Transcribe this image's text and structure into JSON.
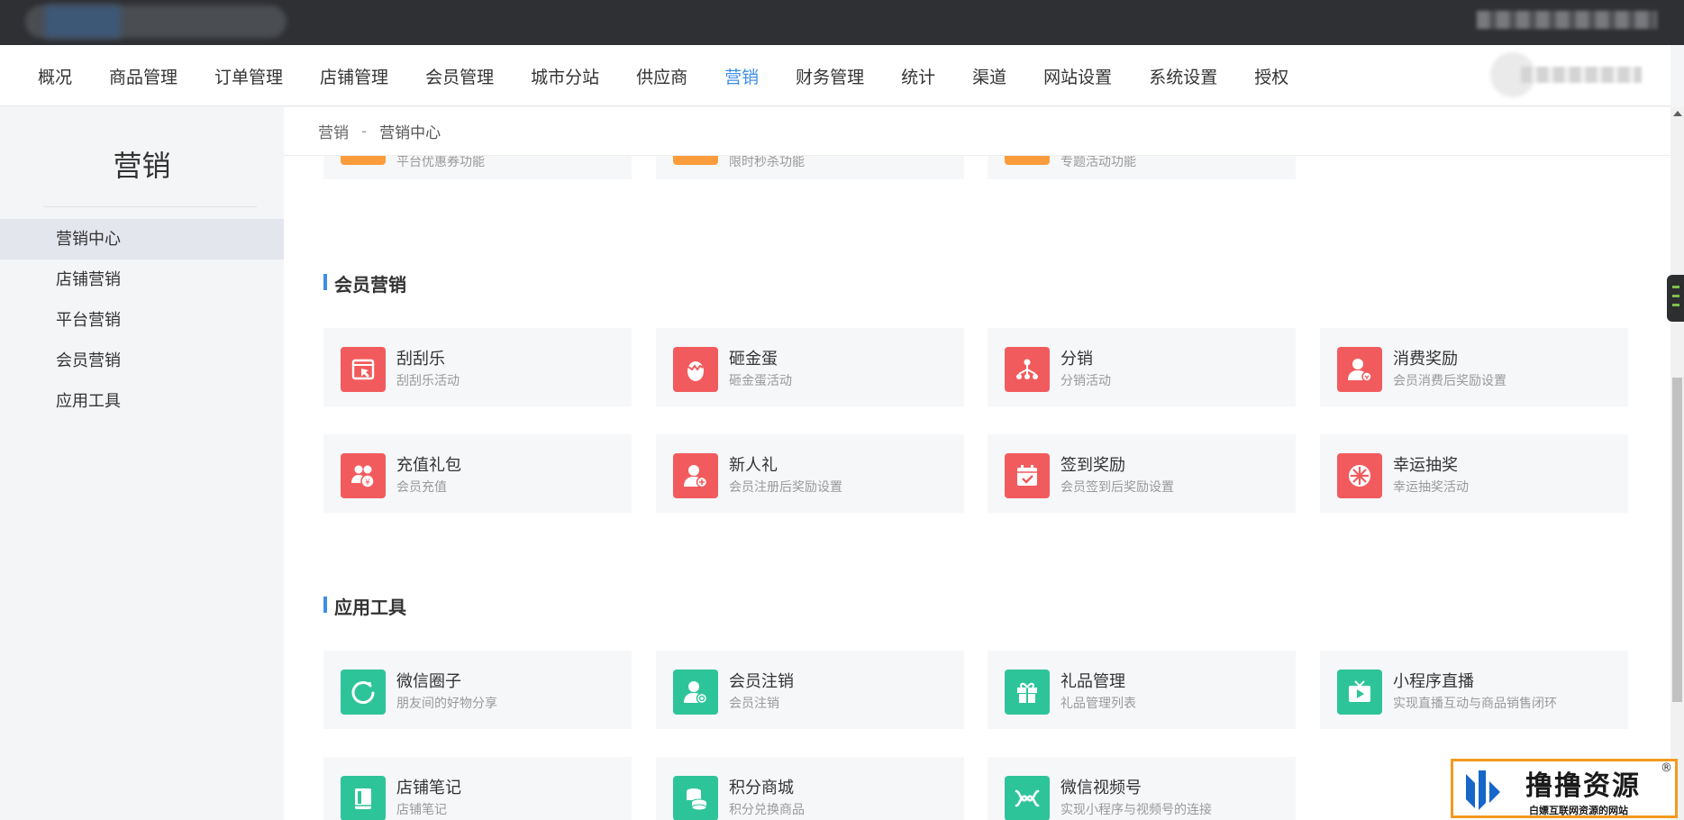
{
  "nav": {
    "items": [
      "概况",
      "商品管理",
      "订单管理",
      "店铺管理",
      "会员管理",
      "城市分站",
      "供应商",
      "营销",
      "财务管理",
      "统计",
      "渠道",
      "网站设置",
      "系统设置",
      "授权"
    ],
    "active_index": 7
  },
  "sidebar": {
    "title": "营销",
    "items": [
      "营销中心",
      "店铺营销",
      "平台营销",
      "会员营销",
      "应用工具"
    ],
    "active_index": 0
  },
  "breadcrumb": {
    "parent": "营销",
    "separator": "-",
    "current": "营销中心"
  },
  "top_cards": [
    {
      "desc": "平台优惠券功能",
      "icon": "coupon-icon",
      "color": "#fb9c3c"
    },
    {
      "desc": "限时秒杀功能",
      "icon": "flash-sale-icon",
      "color": "#fb9c3c"
    },
    {
      "desc": "专题活动功能",
      "icon": "topic-icon",
      "color": "#fb9c3c"
    }
  ],
  "sections": {
    "member": {
      "title": "会员营销",
      "cards": [
        {
          "title": "刮刮乐",
          "desc": "刮刮乐活动",
          "icon": "scratch-card-icon"
        },
        {
          "title": "砸金蛋",
          "desc": "砸金蛋活动",
          "icon": "golden-egg-icon"
        },
        {
          "title": "分销",
          "desc": "分销活动",
          "icon": "distribution-icon"
        },
        {
          "title": "消费奖励",
          "desc": "会员消费后奖励设置",
          "icon": "consume-reward-icon"
        },
        {
          "title": "充值礼包",
          "desc": "会员充值",
          "icon": "recharge-gift-icon"
        },
        {
          "title": "新人礼",
          "desc": "会员注册后奖励设置",
          "icon": "newcomer-gift-icon"
        },
        {
          "title": "签到奖励",
          "desc": "会员签到后奖励设置",
          "icon": "checkin-reward-icon"
        },
        {
          "title": "幸运抽奖",
          "desc": "幸运抽奖活动",
          "icon": "lucky-draw-icon"
        }
      ]
    },
    "tools": {
      "title": "应用工具",
      "cards": [
        {
          "title": "微信圈子",
          "desc": "朋友间的好物分享",
          "icon": "wechat-circle-icon"
        },
        {
          "title": "会员注销",
          "desc": "会员注销",
          "icon": "member-cancel-icon"
        },
        {
          "title": "礼品管理",
          "desc": "礼品管理列表",
          "icon": "gift-manage-icon"
        },
        {
          "title": "小程序直播",
          "desc": "实现直播互动与商品销售闭环",
          "icon": "live-stream-icon"
        },
        {
          "title": "店铺笔记",
          "desc": "店铺笔记",
          "icon": "store-notes-icon"
        },
        {
          "title": "积分商城",
          "desc": "积分兑换商品",
          "icon": "points-mall-icon"
        },
        {
          "title": "微信视频号",
          "desc": "实现小程序与视频号的连接",
          "icon": "wechat-channels-icon"
        }
      ]
    }
  },
  "colors": {
    "accent": "#3d8ee6",
    "member_icon": "#f25b5d",
    "tool_icon": "#2ec49a",
    "promo_icon": "#fb9c3c"
  },
  "watermark": {
    "title": "撸撸资源",
    "subtitle": "白嫖互联网资源的网站",
    "registered": "®"
  }
}
